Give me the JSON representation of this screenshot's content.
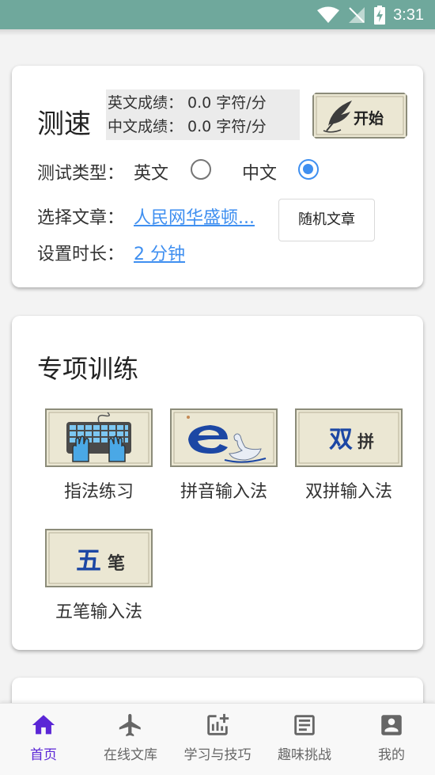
{
  "status_bar": {
    "time": "3:31"
  },
  "speed_test": {
    "title": "测速",
    "english_score": "英文成绩： 0.0 字符/分",
    "chinese_score": "中文成绩： 0.0 字符/分",
    "start_label": "开始",
    "test_type_label": "测试类型：",
    "english_option": "英文",
    "chinese_option": "中文",
    "selected": "中文",
    "article_label": "选择文章：",
    "article_value": "人民网华盛顿...",
    "duration_label": "设置时长：",
    "duration_value": "2 分钟",
    "random_button": "随机文章"
  },
  "training": {
    "title": "专项训练",
    "items": [
      {
        "label": "指法练习",
        "icon": "keyboard-hands-icon"
      },
      {
        "label": "拼音输入法",
        "icon": "pinyin-e-swan-icon"
      },
      {
        "label": "双拼输入法",
        "icon": "shuangpin-icon",
        "text1": "双",
        "text2": "拼"
      },
      {
        "label": "五笔输入法",
        "icon": "wubi-icon",
        "text1": "五",
        "text2": "笔"
      }
    ]
  },
  "bottom_nav": {
    "items": [
      {
        "label": "首页",
        "icon": "home-icon",
        "active": true
      },
      {
        "label": "在线文库",
        "icon": "airplane-icon",
        "active": false
      },
      {
        "label": "学习与技巧",
        "icon": "chart-add-icon",
        "active": false
      },
      {
        "label": "趣味挑战",
        "icon": "article-icon",
        "active": false
      },
      {
        "label": "我的",
        "icon": "account-icon",
        "active": false
      }
    ]
  },
  "colors": {
    "status_bar": "#6fa89c",
    "accent": "#3f8ff0",
    "nav_active": "#5b26d6"
  }
}
